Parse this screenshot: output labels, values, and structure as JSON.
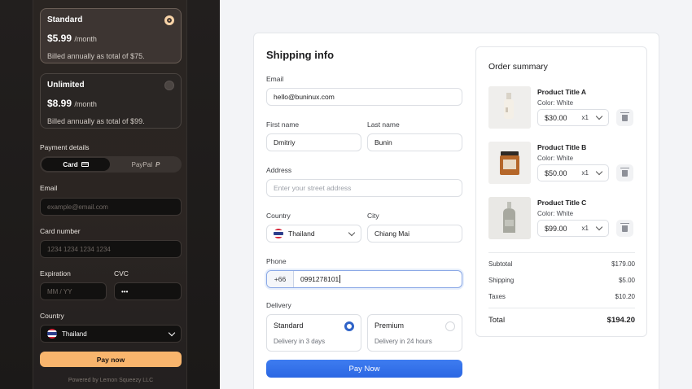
{
  "plans": [
    {
      "name": "Standard",
      "price": "$5.99",
      "per": "/month",
      "note": "Billed annually as total of $75.",
      "selected": true
    },
    {
      "name": "Unlimited",
      "price": "$8.99",
      "per": "/month",
      "note": "Billed annually as total of $99.",
      "selected": false
    }
  ],
  "left": {
    "payment_details_label": "Payment details",
    "tab_card": "Card",
    "tab_paypal": "PayPal",
    "email_label": "Email",
    "email_placeholder": "example@email.com",
    "card_label": "Card number",
    "card_placeholder": "1234 1234 1234 1234",
    "expiration_label": "Expiration",
    "expiration_placeholder": "MM / YY",
    "cvc_label": "CVC",
    "cvc_value": "•••",
    "country_label": "Country",
    "country_value": "Thailand",
    "pay_button": "Pay now",
    "powered": "Powered by Lemon Squeezy LLC"
  },
  "shipping": {
    "title": "Shipping info",
    "email_label": "Email",
    "email_value": "hello@buninux.com",
    "first_name_label": "First name",
    "first_name_value": "Dmitriy",
    "last_name_label": "Last name",
    "last_name_value": "Bunin",
    "address_label": "Address",
    "address_placeholder": "Enter your street address",
    "country_label": "Country",
    "country_value": "Thailand",
    "city_label": "City",
    "city_value": "Chiang Mai",
    "phone_label": "Phone",
    "phone_code": "+66",
    "phone_value": "0991278101",
    "delivery_label": "Delivery",
    "delivery_options": [
      {
        "name": "Standard",
        "sub": "Delivery in 3 days",
        "selected": true
      },
      {
        "name": "Premium",
        "sub": "Delivery in 24 hours",
        "selected": false
      }
    ],
    "pay_button": "Pay Now"
  },
  "summary": {
    "title": "Order summary",
    "products": [
      {
        "title": "Product Title A",
        "color": "Color: White",
        "price": "$30.00",
        "qty": "x1"
      },
      {
        "title": "Product Title B",
        "color": "Color: White",
        "price": "$50.00",
        "qty": "x1"
      },
      {
        "title": "Product Title C",
        "color": "Color: White",
        "price": "$99.00",
        "qty": "x1"
      }
    ],
    "subtotal_label": "Subtotal",
    "subtotal": "$179.00",
    "shipping_label": "Shipping",
    "shipping": "$5.00",
    "taxes_label": "Taxes",
    "taxes": "$10.20",
    "total_label": "Total",
    "total": "$194.20"
  },
  "colors": {
    "accent_blue": "#2b67e3",
    "pay_orange": "#f8b56d",
    "dark_panel": "#2a2522"
  }
}
